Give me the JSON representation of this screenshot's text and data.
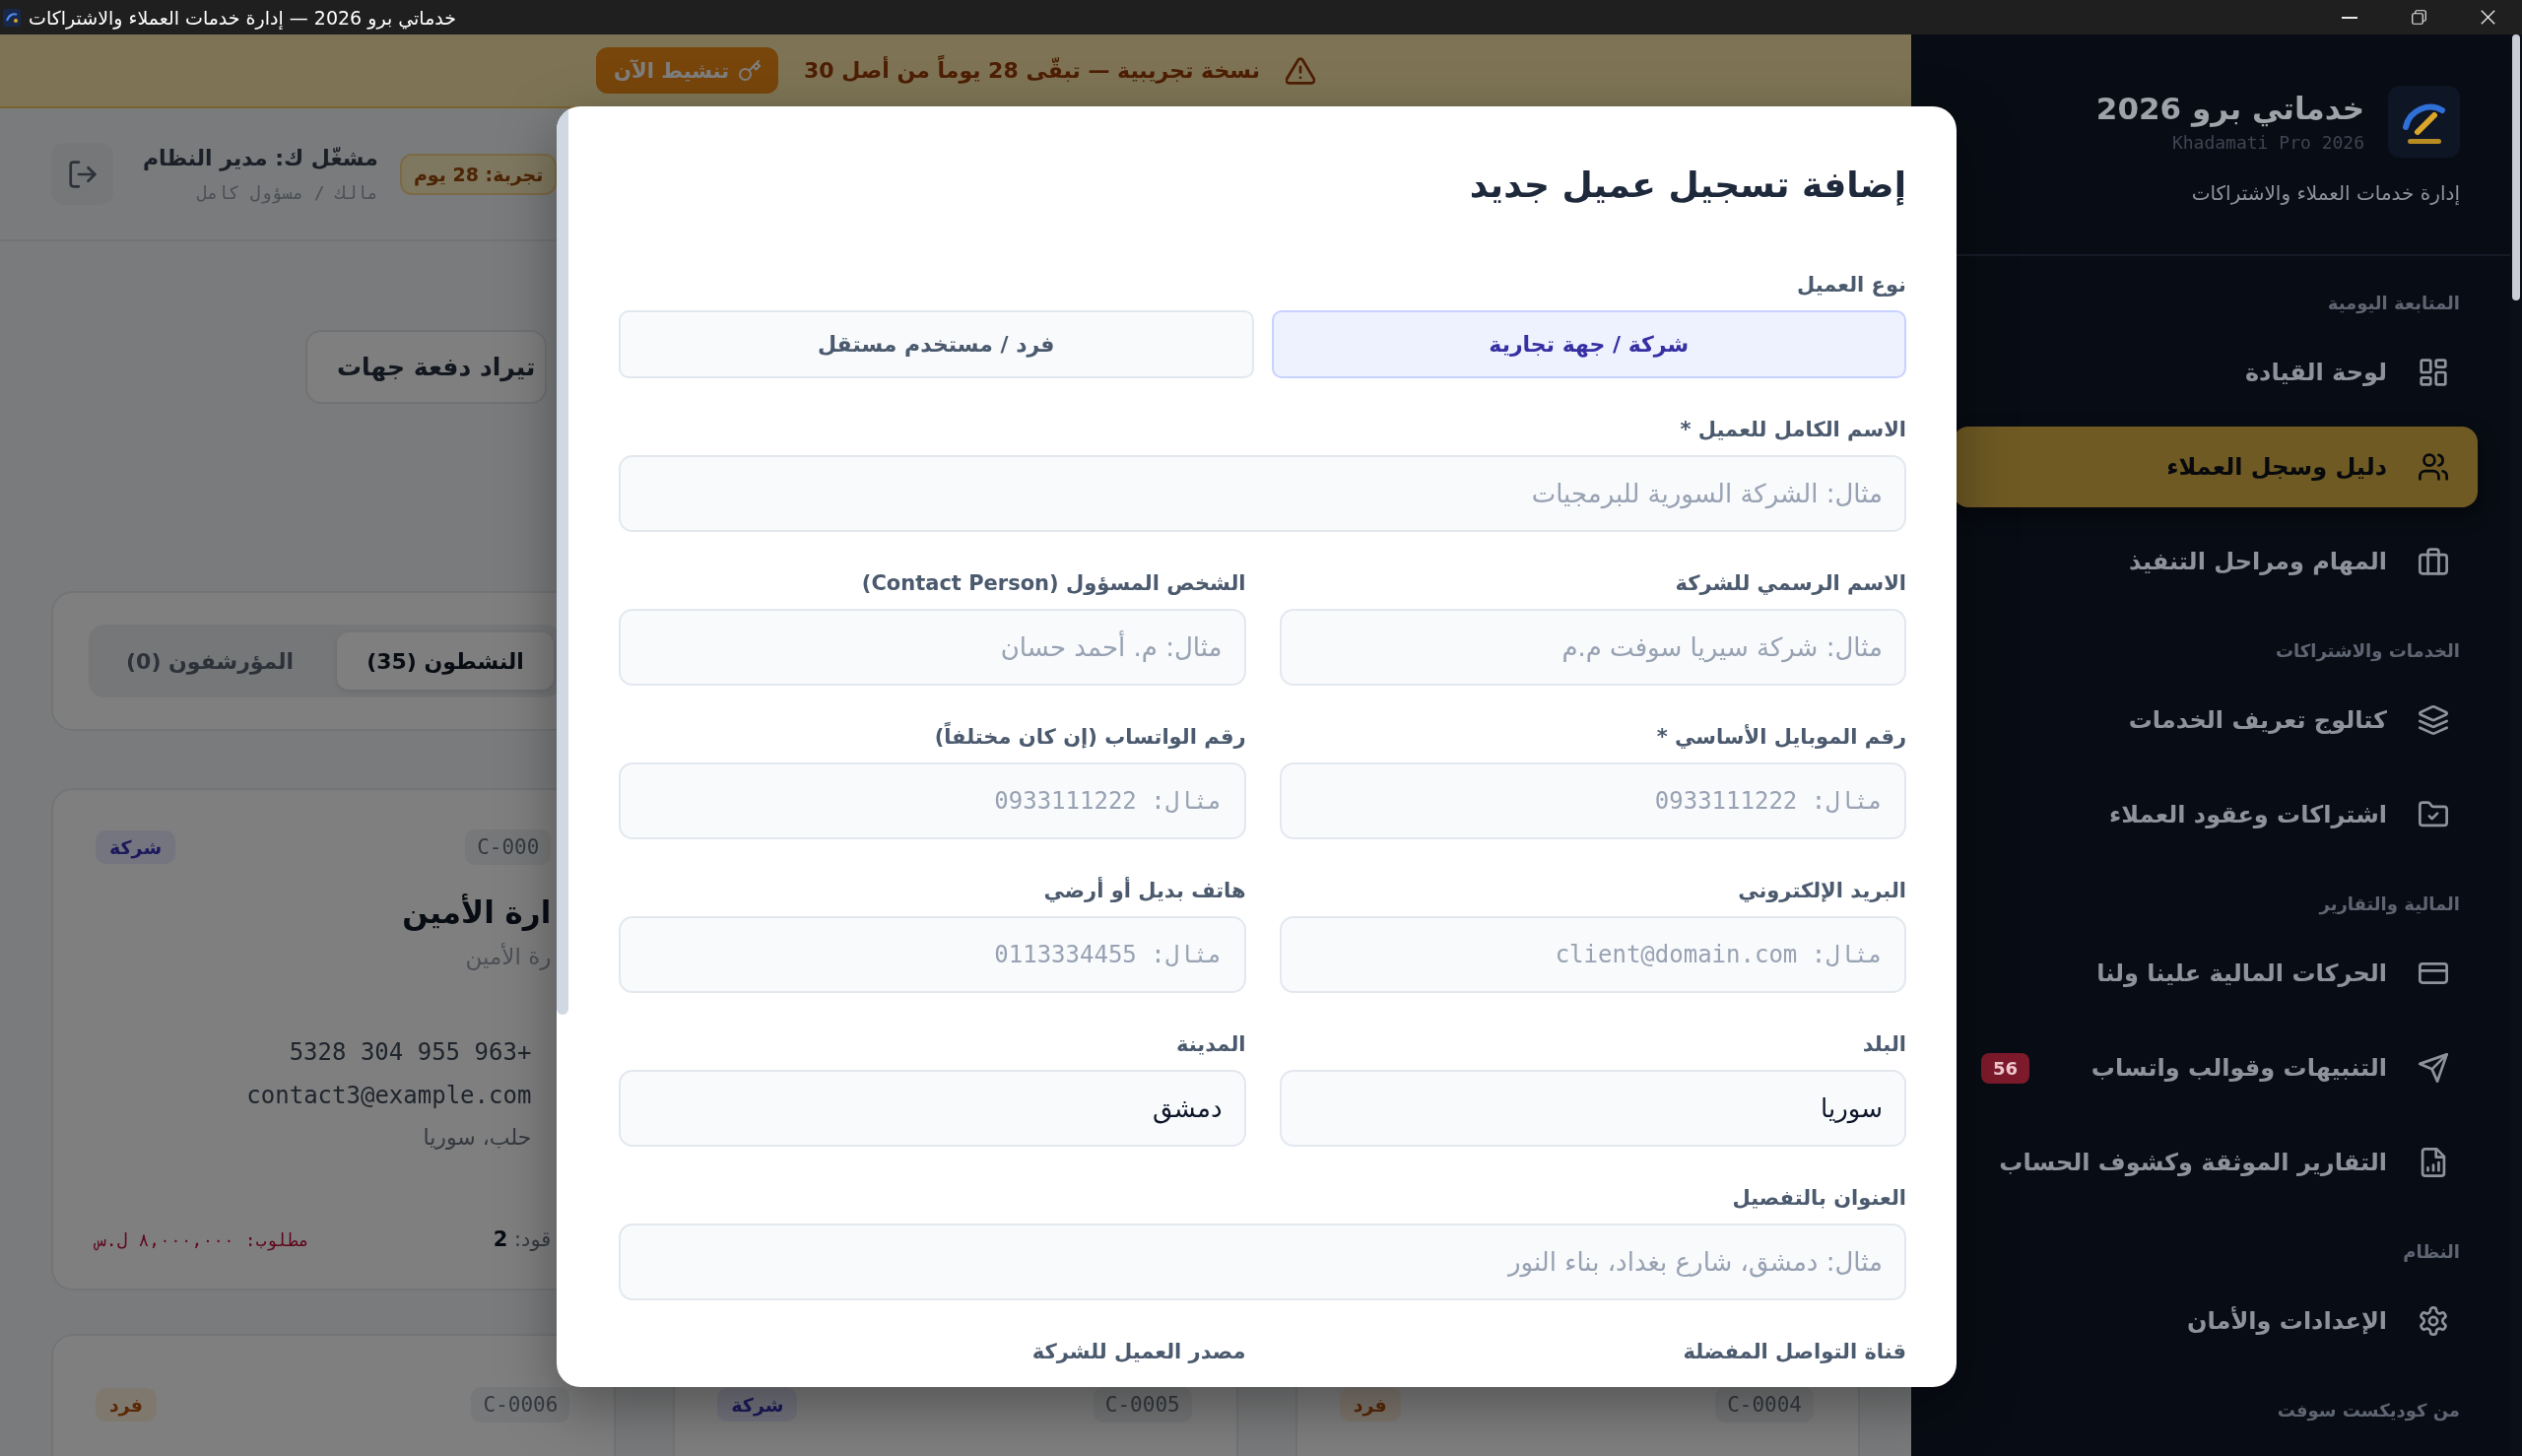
{
  "window": {
    "title": "خدماتي برو 2026 — إدارة خدمات العملاء والاشتراكات"
  },
  "sidebar": {
    "app_name": "خدماتي برو 2026",
    "app_name_latin": "Khadamati Pro 2026",
    "tagline": "إدارة خدمات العملاء والاشتراكات",
    "sections": [
      {
        "title": "المتابعة اليومية",
        "items": [
          {
            "label": "لوحة القيادة",
            "selected": false
          },
          {
            "label": "دليل وسجل العملاء",
            "selected": true
          },
          {
            "label": "المهام ومراحل التنفيذ",
            "selected": false
          }
        ]
      },
      {
        "title": "الخدمات والاشتراكات",
        "items": [
          {
            "label": "كتالوج تعريف الخدمات",
            "selected": false
          },
          {
            "label": "اشتراكات وعقود العملاء",
            "selected": false
          }
        ]
      },
      {
        "title": "المالية والتقارير",
        "items": [
          {
            "label": "الحركات المالية علينا ولنا",
            "selected": false
          },
          {
            "label": "التنبيهات وقوالب واتساب",
            "selected": false,
            "badge": "56"
          },
          {
            "label": "التقارير الموثقة وكشوف الحساب",
            "selected": false
          }
        ]
      },
      {
        "title": "النظام",
        "items": [
          {
            "label": "الإعدادات والأمان",
            "selected": false
          }
        ]
      },
      {
        "title": "من كوديكست سوفت"
      }
    ]
  },
  "trial_banner": {
    "message": "نسخة تجريبية — تبقّى 28 يوماً من أصل 30",
    "button": "تنشيط الآن"
  },
  "header": {
    "trial_badge": "تجربة: 28 يوم",
    "user_name": "مشغّل ك: مدير النظام",
    "user_role": "مالك / مسؤول كامل"
  },
  "toolbar": {
    "import_button": "تيراد دفعة جهات"
  },
  "status_tabs": [
    {
      "label": "النشطون (35)",
      "selected": true
    },
    {
      "label": "المؤرشفون (0)",
      "selected": false
    }
  ],
  "client_cards": [
    {
      "kind": "company",
      "code": "C-000",
      "type_badge": "شركة",
      "name": "ارة الأمين",
      "subtitle": "رة الأمين",
      "phone": "+963 955 304 5328",
      "email": "contact3@example.com",
      "location": "حلب، سوريا",
      "contracts": "قود: **2**",
      "due": "مطلوب: ٨,٠٠٠,٠٠٠ ل.س"
    },
    {
      "kind": "individual",
      "code": "C-0004",
      "type_badge": "فرد"
    },
    {
      "kind": "company",
      "code": "C-0005",
      "type_badge": "شركة"
    },
    {
      "kind": "individual",
      "code": "C-0006",
      "type_badge": "فرد"
    }
  ],
  "modal": {
    "title": "إضافة تسجيل عميل جديد",
    "client_type": {
      "label": "نوع العميل",
      "options": [
        {
          "label": "شركة / جهة تجارية",
          "selected": true
        },
        {
          "label": "فرد / مستخدم مستقل",
          "selected": false
        }
      ]
    },
    "rows": [
      {
        "fields": [
          {
            "kind": "text",
            "label": "الاسم الكامل للعميل *",
            "placeholder": "مثال: الشركة السورية للبرمجيات"
          }
        ]
      },
      {
        "fields": [
          {
            "kind": "text",
            "label": "الاسم الرسمي للشركة",
            "placeholder": "مثال: شركة سيريا سوفت م.م"
          },
          {
            "kind": "text",
            "label": "الشخص المسؤول (Contact Person)",
            "placeholder": "مثال: م. أحمد حسان"
          }
        ]
      },
      {
        "fields": [
          {
            "kind": "phone",
            "label": "رقم الموبايل الأساسي *",
            "placeholder": "مثال: 0933111222"
          },
          {
            "kind": "phone",
            "label": "رقم الواتساب (إن كان مختلفاً)",
            "placeholder": "مثال: 0933111222"
          }
        ]
      },
      {
        "fields": [
          {
            "kind": "email",
            "label": "البريد الإلكتروني",
            "placeholder": "مثال: client@domain.com"
          },
          {
            "kind": "phone",
            "label": "هاتف بديل أو أرضي",
            "placeholder": "مثال: 0113334455"
          }
        ]
      },
      {
        "fields": [
          {
            "kind": "text",
            "label": "البلد",
            "value": "سوريا"
          },
          {
            "kind": "text",
            "label": "المدينة",
            "value": "دمشق"
          }
        ]
      },
      {
        "fields": [
          {
            "kind": "text",
            "label": "العنوان بالتفصيل",
            "placeholder": "مثال: دمشق، شارع بغداد، بناء النور"
          }
        ]
      },
      {
        "fields": [
          {
            "label": "قناة التواصل المفضلة"
          },
          {
            "label": "مصدر العميل للشركة"
          }
        ]
      }
    ]
  }
}
